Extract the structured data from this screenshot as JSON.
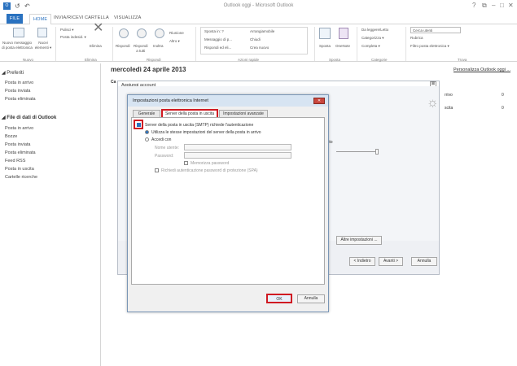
{
  "app": {
    "title": "Outlook oggi - Microsoft Outlook"
  },
  "window": {
    "help": "?",
    "restore": "⧉",
    "minimize": "–",
    "maximize": "□",
    "close": "✕"
  },
  "quick_access": {
    "send": "↺",
    "undo": "↶"
  },
  "tabs": [
    "FILE",
    "HOME",
    "INVIA/RICEVI",
    "CARTELLA",
    "VISUALIZZA"
  ],
  "ribbon": {
    "new_message": "Nuovo messaggio\ndi posta elettronica",
    "new_items": "Nuovi\nelementi ▾",
    "group_new": "Nuovo",
    "ignore": "Pulisci ▾",
    "junk": "Posta indesid. ▾",
    "delete": "Elimina",
    "group_delete": "Elimina",
    "reply": "Rispondi",
    "reply_all": "Rispondi\na tutti",
    "forward": "Inoltra",
    "meeting": "Riunione",
    "more": "Altro ▾",
    "group_respond": "Rispondi",
    "move_to": "Sposta in: ?",
    "to_manager": "Messaggio di p...",
    "team_email": "Rispondi ed eli...",
    "done": "Chiudi",
    "create_new": "Crea nuovo",
    "arrangeable": "Arrangiamobile",
    "group_quicksteps": "Azioni rapide",
    "move": "Sposta",
    "onenote": "OneNote",
    "group_move": "Sposta",
    "unread_read": "Da leggere/Letto",
    "categorize": "Categorizza ▾",
    "followup": "Completa ▾",
    "group_tags": "Categorie",
    "search_people": "Cerca utenti",
    "address_book": "Rubrica",
    "filter_email": "Filtro posta elettronica ▾",
    "group_find": "Trova"
  },
  "sidebar": {
    "favorites_header": "◢ Preferiti",
    "favorites": [
      "Posta in arrivo",
      "Posta inviata",
      "Posta eliminata"
    ],
    "data_header": "◢ File di dati di Outlook",
    "folders": [
      "Posta in arrivo",
      "Bozze",
      "Posta inviata",
      "Posta eliminata",
      "Feed RSS",
      "Posta in uscita",
      "Cartelle ricerche"
    ]
  },
  "main": {
    "date": "mercoledì 24 aprile 2013",
    "personalize": "Personalizza Outlook oggi ...",
    "right_col": [
      {
        "label": "rrivo",
        "count": "0"
      },
      {
        "label": "scita",
        "count": "0"
      }
    ],
    "obscured_left": "Ca",
    "obscured_mid": "tto"
  },
  "wizard": {
    "title": "Aggiungi account",
    "more_settings": "Altre impostazioni ...",
    "back": "< Indietro",
    "next": "Avanti >",
    "cancel": "Annulla",
    "ctrl": "⊠"
  },
  "dialog": {
    "title": "Impostazioni posta elettronica Internet",
    "close": "✕",
    "tabs": [
      "Generale",
      "Server della posta in uscita",
      "Impostazioni avanzate"
    ],
    "smtp_auth": "Server della posta in uscita (SMTP) richiede l'autenticazione",
    "use_same": "Utilizza le stesse impostazioni del server della posta in arrivo",
    "logon_with": "Accedi con",
    "username_label": "Nome utente:",
    "password_label": "Password:",
    "remember": "Memorizza password",
    "spa": "Richiedi autenticazione password di protezione (SPA)",
    "ok": "OK",
    "cancel": "Annulla"
  },
  "colors": {
    "accent": "#2a72c0",
    "highlight": "#d01a22"
  }
}
